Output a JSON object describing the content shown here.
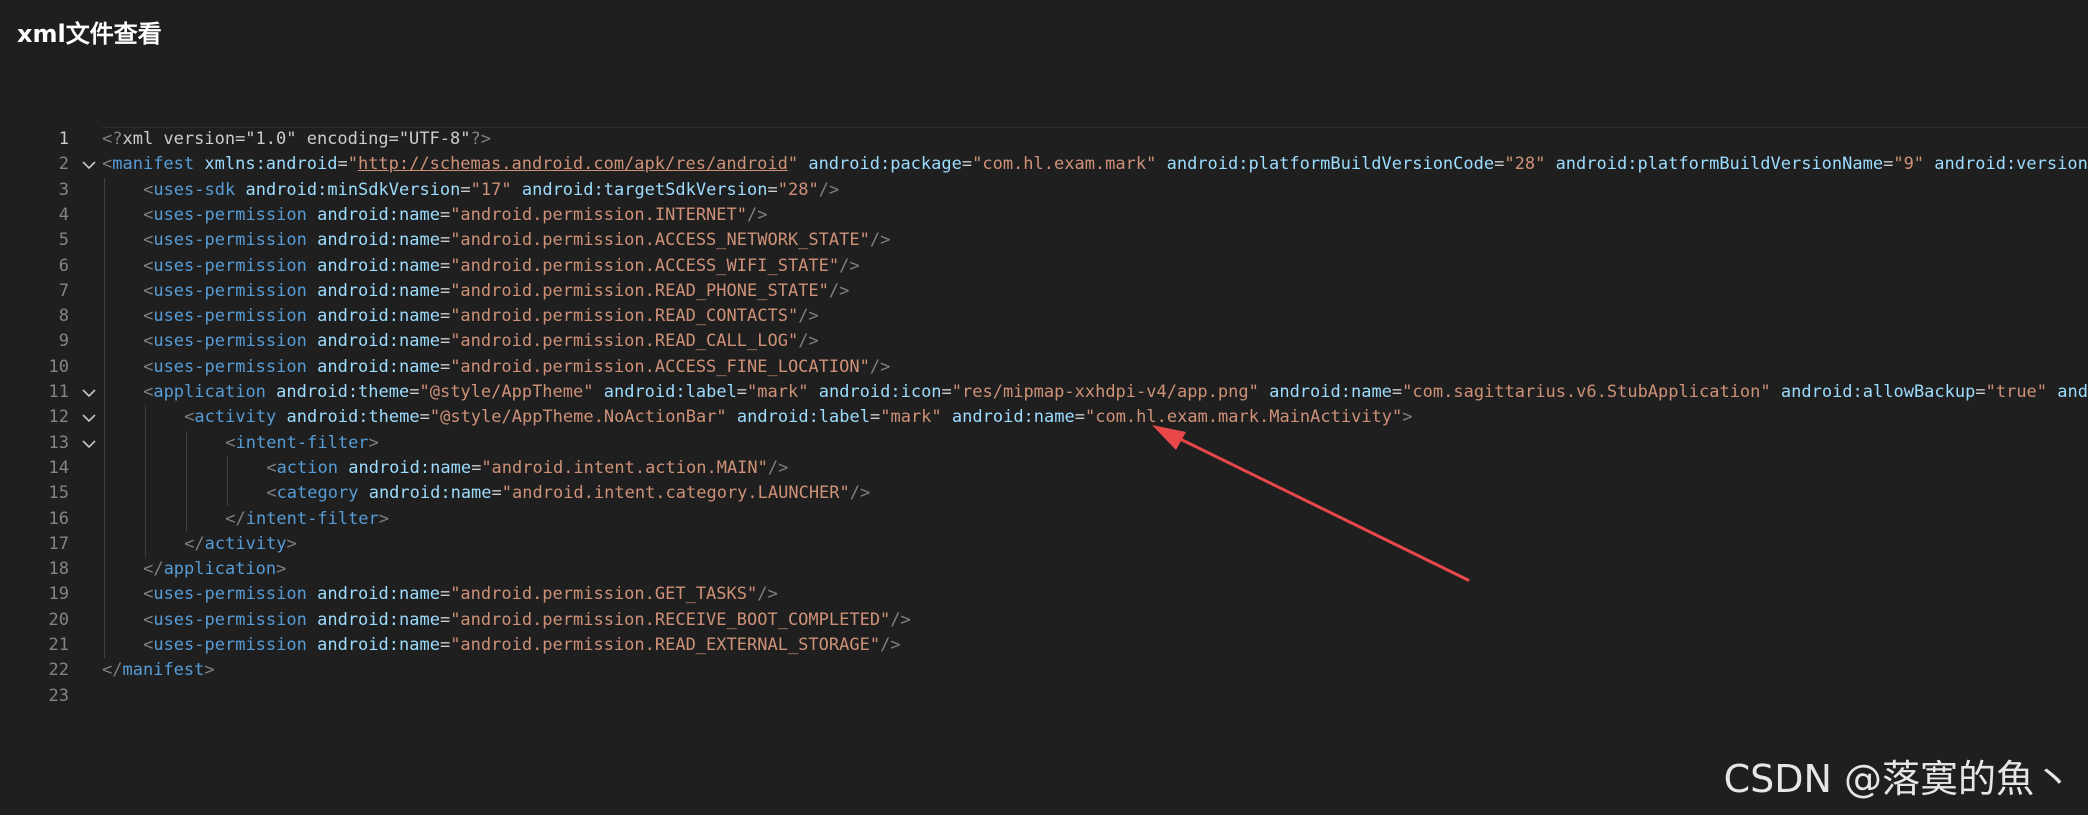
{
  "page": {
    "title": "xml文件查看"
  },
  "editor": {
    "lines": [
      {
        "n": "1",
        "fold": false,
        "indent": 0,
        "tokens": [
          [
            "p",
            "<?"
          ],
          [
            "x",
            "xml version=\"1.0\" encoding=\"UTF-8\""
          ],
          [
            "p",
            "?>"
          ]
        ]
      },
      {
        "n": "2",
        "fold": true,
        "indent": 0,
        "tokens": [
          [
            "p",
            "<"
          ],
          [
            "t",
            "manifest"
          ],
          [
            "x",
            " "
          ],
          [
            "a",
            "xmlns:android"
          ],
          [
            "x",
            "="
          ],
          [
            "s",
            "\""
          ],
          [
            "l",
            "http://schemas.android.com/apk/res/android"
          ],
          [
            "s",
            "\""
          ],
          [
            "x",
            " "
          ],
          [
            "a",
            "android:package"
          ],
          [
            "x",
            "="
          ],
          [
            "s",
            "\"com.hl.exam.mark\""
          ],
          [
            "x",
            " "
          ],
          [
            "a",
            "android:platformBuildVersionCode"
          ],
          [
            "x",
            "="
          ],
          [
            "s",
            "\"28\""
          ],
          [
            "x",
            " "
          ],
          [
            "a",
            "android:platformBuildVersionName"
          ],
          [
            "x",
            "="
          ],
          [
            "s",
            "\"9\""
          ],
          [
            "x",
            " "
          ],
          [
            "a",
            "android:version"
          ]
        ]
      },
      {
        "n": "3",
        "fold": false,
        "indent": 1,
        "tokens": [
          [
            "p",
            "<"
          ],
          [
            "t",
            "uses-sdk"
          ],
          [
            "x",
            " "
          ],
          [
            "a",
            "android:minSdkVersion"
          ],
          [
            "x",
            "="
          ],
          [
            "s",
            "\"17\""
          ],
          [
            "x",
            " "
          ],
          [
            "a",
            "android:targetSdkVersion"
          ],
          [
            "x",
            "="
          ],
          [
            "s",
            "\"28\""
          ],
          [
            "p",
            "/>"
          ]
        ]
      },
      {
        "n": "4",
        "fold": false,
        "indent": 1,
        "tokens": [
          [
            "p",
            "<"
          ],
          [
            "t",
            "uses-permission"
          ],
          [
            "x",
            " "
          ],
          [
            "a",
            "android:name"
          ],
          [
            "x",
            "="
          ],
          [
            "s",
            "\"android.permission.INTERNET\""
          ],
          [
            "p",
            "/>"
          ]
        ]
      },
      {
        "n": "5",
        "fold": false,
        "indent": 1,
        "tokens": [
          [
            "p",
            "<"
          ],
          [
            "t",
            "uses-permission"
          ],
          [
            "x",
            " "
          ],
          [
            "a",
            "android:name"
          ],
          [
            "x",
            "="
          ],
          [
            "s",
            "\"android.permission.ACCESS_NETWORK_STATE\""
          ],
          [
            "p",
            "/>"
          ]
        ]
      },
      {
        "n": "6",
        "fold": false,
        "indent": 1,
        "tokens": [
          [
            "p",
            "<"
          ],
          [
            "t",
            "uses-permission"
          ],
          [
            "x",
            " "
          ],
          [
            "a",
            "android:name"
          ],
          [
            "x",
            "="
          ],
          [
            "s",
            "\"android.permission.ACCESS_WIFI_STATE\""
          ],
          [
            "p",
            "/>"
          ]
        ]
      },
      {
        "n": "7",
        "fold": false,
        "indent": 1,
        "tokens": [
          [
            "p",
            "<"
          ],
          [
            "t",
            "uses-permission"
          ],
          [
            "x",
            " "
          ],
          [
            "a",
            "android:name"
          ],
          [
            "x",
            "="
          ],
          [
            "s",
            "\"android.permission.READ_PHONE_STATE\""
          ],
          [
            "p",
            "/>"
          ]
        ]
      },
      {
        "n": "8",
        "fold": false,
        "indent": 1,
        "tokens": [
          [
            "p",
            "<"
          ],
          [
            "t",
            "uses-permission"
          ],
          [
            "x",
            " "
          ],
          [
            "a",
            "android:name"
          ],
          [
            "x",
            "="
          ],
          [
            "s",
            "\"android.permission.READ_CONTACTS\""
          ],
          [
            "p",
            "/>"
          ]
        ]
      },
      {
        "n": "9",
        "fold": false,
        "indent": 1,
        "tokens": [
          [
            "p",
            "<"
          ],
          [
            "t",
            "uses-permission"
          ],
          [
            "x",
            " "
          ],
          [
            "a",
            "android:name"
          ],
          [
            "x",
            "="
          ],
          [
            "s",
            "\"android.permission.READ_CALL_LOG\""
          ],
          [
            "p",
            "/>"
          ]
        ]
      },
      {
        "n": "10",
        "fold": false,
        "indent": 1,
        "tokens": [
          [
            "p",
            "<"
          ],
          [
            "t",
            "uses-permission"
          ],
          [
            "x",
            " "
          ],
          [
            "a",
            "android:name"
          ],
          [
            "x",
            "="
          ],
          [
            "s",
            "\"android.permission.ACCESS_FINE_LOCATION\""
          ],
          [
            "p",
            "/>"
          ]
        ]
      },
      {
        "n": "11",
        "fold": true,
        "indent": 1,
        "tokens": [
          [
            "p",
            "<"
          ],
          [
            "t",
            "application"
          ],
          [
            "x",
            " "
          ],
          [
            "a",
            "android:theme"
          ],
          [
            "x",
            "="
          ],
          [
            "s",
            "\"@style/AppTheme\""
          ],
          [
            "x",
            " "
          ],
          [
            "a",
            "android:label"
          ],
          [
            "x",
            "="
          ],
          [
            "s",
            "\"mark\""
          ],
          [
            "x",
            " "
          ],
          [
            "a",
            "android:icon"
          ],
          [
            "x",
            "="
          ],
          [
            "s",
            "\"res/mipmap-xxhdpi-v4/app.png\""
          ],
          [
            "x",
            " "
          ],
          [
            "a",
            "android:name"
          ],
          [
            "x",
            "="
          ],
          [
            "s",
            "\"com.sagittarius.v6.StubApplication\""
          ],
          [
            "x",
            " "
          ],
          [
            "a",
            "android:allowBackup"
          ],
          [
            "x",
            "="
          ],
          [
            "s",
            "\"true\""
          ],
          [
            "x",
            " "
          ],
          [
            "a",
            "and"
          ]
        ]
      },
      {
        "n": "12",
        "fold": true,
        "indent": 2,
        "tokens": [
          [
            "p",
            "<"
          ],
          [
            "t",
            "activity"
          ],
          [
            "x",
            " "
          ],
          [
            "a",
            "android:theme"
          ],
          [
            "x",
            "="
          ],
          [
            "s",
            "\"@style/AppTheme.NoActionBar\""
          ],
          [
            "x",
            " "
          ],
          [
            "a",
            "android:label"
          ],
          [
            "x",
            "="
          ],
          [
            "s",
            "\"mark\""
          ],
          [
            "x",
            " "
          ],
          [
            "a",
            "android:name"
          ],
          [
            "x",
            "="
          ],
          [
            "s",
            "\"com.hl.exam.mark.MainActivity\""
          ],
          [
            "p",
            ">"
          ]
        ]
      },
      {
        "n": "13",
        "fold": true,
        "indent": 3,
        "tokens": [
          [
            "p",
            "<"
          ],
          [
            "t",
            "intent-filter"
          ],
          [
            "p",
            ">"
          ]
        ]
      },
      {
        "n": "14",
        "fold": false,
        "indent": 4,
        "tokens": [
          [
            "p",
            "<"
          ],
          [
            "t",
            "action"
          ],
          [
            "x",
            " "
          ],
          [
            "a",
            "android:name"
          ],
          [
            "x",
            "="
          ],
          [
            "s",
            "\"android.intent.action.MAIN\""
          ],
          [
            "p",
            "/>"
          ]
        ]
      },
      {
        "n": "15",
        "fold": false,
        "indent": 4,
        "tokens": [
          [
            "p",
            "<"
          ],
          [
            "t",
            "category"
          ],
          [
            "x",
            " "
          ],
          [
            "a",
            "android:name"
          ],
          [
            "x",
            "="
          ],
          [
            "s",
            "\"android.intent.category.LAUNCHER\""
          ],
          [
            "p",
            "/>"
          ]
        ]
      },
      {
        "n": "16",
        "fold": false,
        "indent": 3,
        "tokens": [
          [
            "p",
            "</"
          ],
          [
            "t",
            "intent-filter"
          ],
          [
            "p",
            ">"
          ]
        ]
      },
      {
        "n": "17",
        "fold": false,
        "indent": 2,
        "tokens": [
          [
            "p",
            "</"
          ],
          [
            "t",
            "activity"
          ],
          [
            "p",
            ">"
          ]
        ]
      },
      {
        "n": "18",
        "fold": false,
        "indent": 1,
        "tokens": [
          [
            "p",
            "</"
          ],
          [
            "t",
            "application"
          ],
          [
            "p",
            ">"
          ]
        ]
      },
      {
        "n": "19",
        "fold": false,
        "indent": 1,
        "tokens": [
          [
            "p",
            "<"
          ],
          [
            "t",
            "uses-permission"
          ],
          [
            "x",
            " "
          ],
          [
            "a",
            "android:name"
          ],
          [
            "x",
            "="
          ],
          [
            "s",
            "\"android.permission.GET_TASKS\""
          ],
          [
            "p",
            "/>"
          ]
        ]
      },
      {
        "n": "20",
        "fold": false,
        "indent": 1,
        "tokens": [
          [
            "p",
            "<"
          ],
          [
            "t",
            "uses-permission"
          ],
          [
            "x",
            " "
          ],
          [
            "a",
            "android:name"
          ],
          [
            "x",
            "="
          ],
          [
            "s",
            "\"android.permission.RECEIVE_BOOT_COMPLETED\""
          ],
          [
            "p",
            "/>"
          ]
        ]
      },
      {
        "n": "21",
        "fold": false,
        "indent": 1,
        "tokens": [
          [
            "p",
            "<"
          ],
          [
            "t",
            "uses-permission"
          ],
          [
            "x",
            " "
          ],
          [
            "a",
            "android:name"
          ],
          [
            "x",
            "="
          ],
          [
            "s",
            "\"android.permission.READ_EXTERNAL_STORAGE\""
          ],
          [
            "p",
            "/>"
          ]
        ]
      },
      {
        "n": "22",
        "fold": false,
        "indent": 0,
        "tokens": [
          [
            "p",
            "</"
          ],
          [
            "t",
            "manifest"
          ],
          [
            "p",
            ">"
          ]
        ]
      },
      {
        "n": "23",
        "fold": false,
        "indent": 0,
        "tokens": []
      }
    ],
    "active_line": "1"
  },
  "annotation": {
    "color": "#e8484a",
    "points_to": "com.hl.exam.mark.MainActivity"
  },
  "watermark": {
    "text": "CSDN @落寞的魚丶"
  },
  "colors": {
    "background": "#1f1f1f",
    "tag": "#569cd6",
    "attribute": "#9cdcfe",
    "string": "#ce9178",
    "punctuation": "#808080",
    "line_number": "#858585"
  },
  "icons": {
    "fold_marker": "chevron-down-icon"
  }
}
